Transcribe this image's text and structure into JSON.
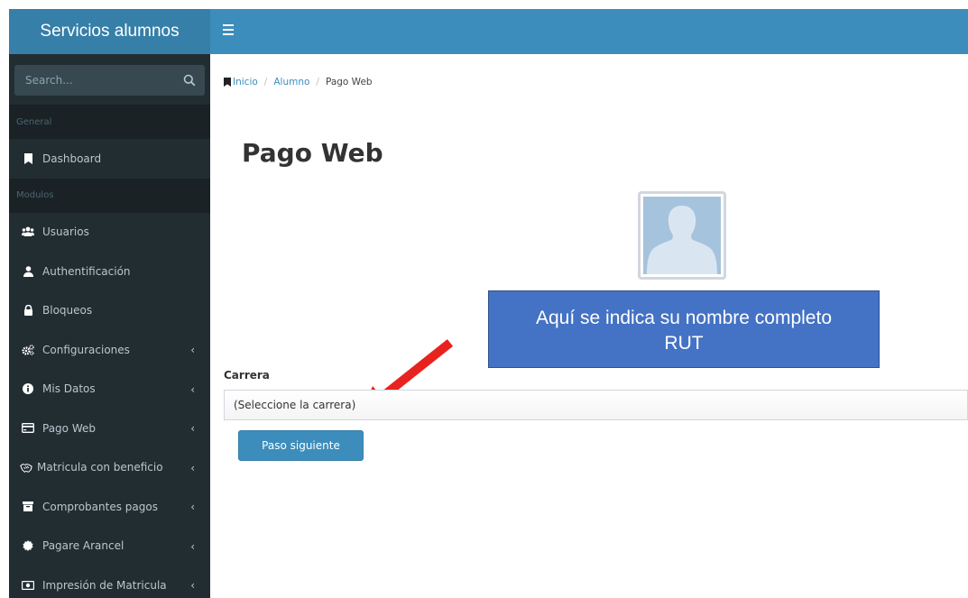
{
  "sidebar": {
    "brand": "Servicios alumnos",
    "search_placeholder": "Search...",
    "sections": {
      "general": "General",
      "modulos": "Modulos"
    },
    "items": {
      "dashboard": "Dashboard",
      "usuarios": "Usuarios",
      "authentificacion": "Authentificación",
      "bloqueos": "Bloqueos",
      "configuraciones": "Configuraciones",
      "mis_datos": "Mis Datos",
      "pago_web": "Pago Web",
      "matricula_beneficio": "Matricula con beneficio",
      "comprobantes_pagos": "Comprobantes pagos",
      "pagare_arancel": "Pagare Arancel",
      "impresion_matricula": "Impresión de Matricula"
    },
    "chevron": "‹"
  },
  "breadcrumb": {
    "inicio": "Inicio",
    "alumno": "Alumno",
    "current": "Pago Web",
    "separator": "/"
  },
  "main": {
    "title": "Pago Web",
    "callout_line1": "Aquí se indica su nombre completo",
    "callout_line2": "RUT",
    "carrera_label": "Carrera",
    "carrera_select": "(Seleccione la carrera)",
    "next_button": "Paso siguiente"
  },
  "colors": {
    "sidebar_bg": "#222d32",
    "brand_bg": "#367fa9",
    "topbar_bg": "#3c8dbc",
    "callout_bg": "#4472c4",
    "arrow": "#e8231f"
  }
}
